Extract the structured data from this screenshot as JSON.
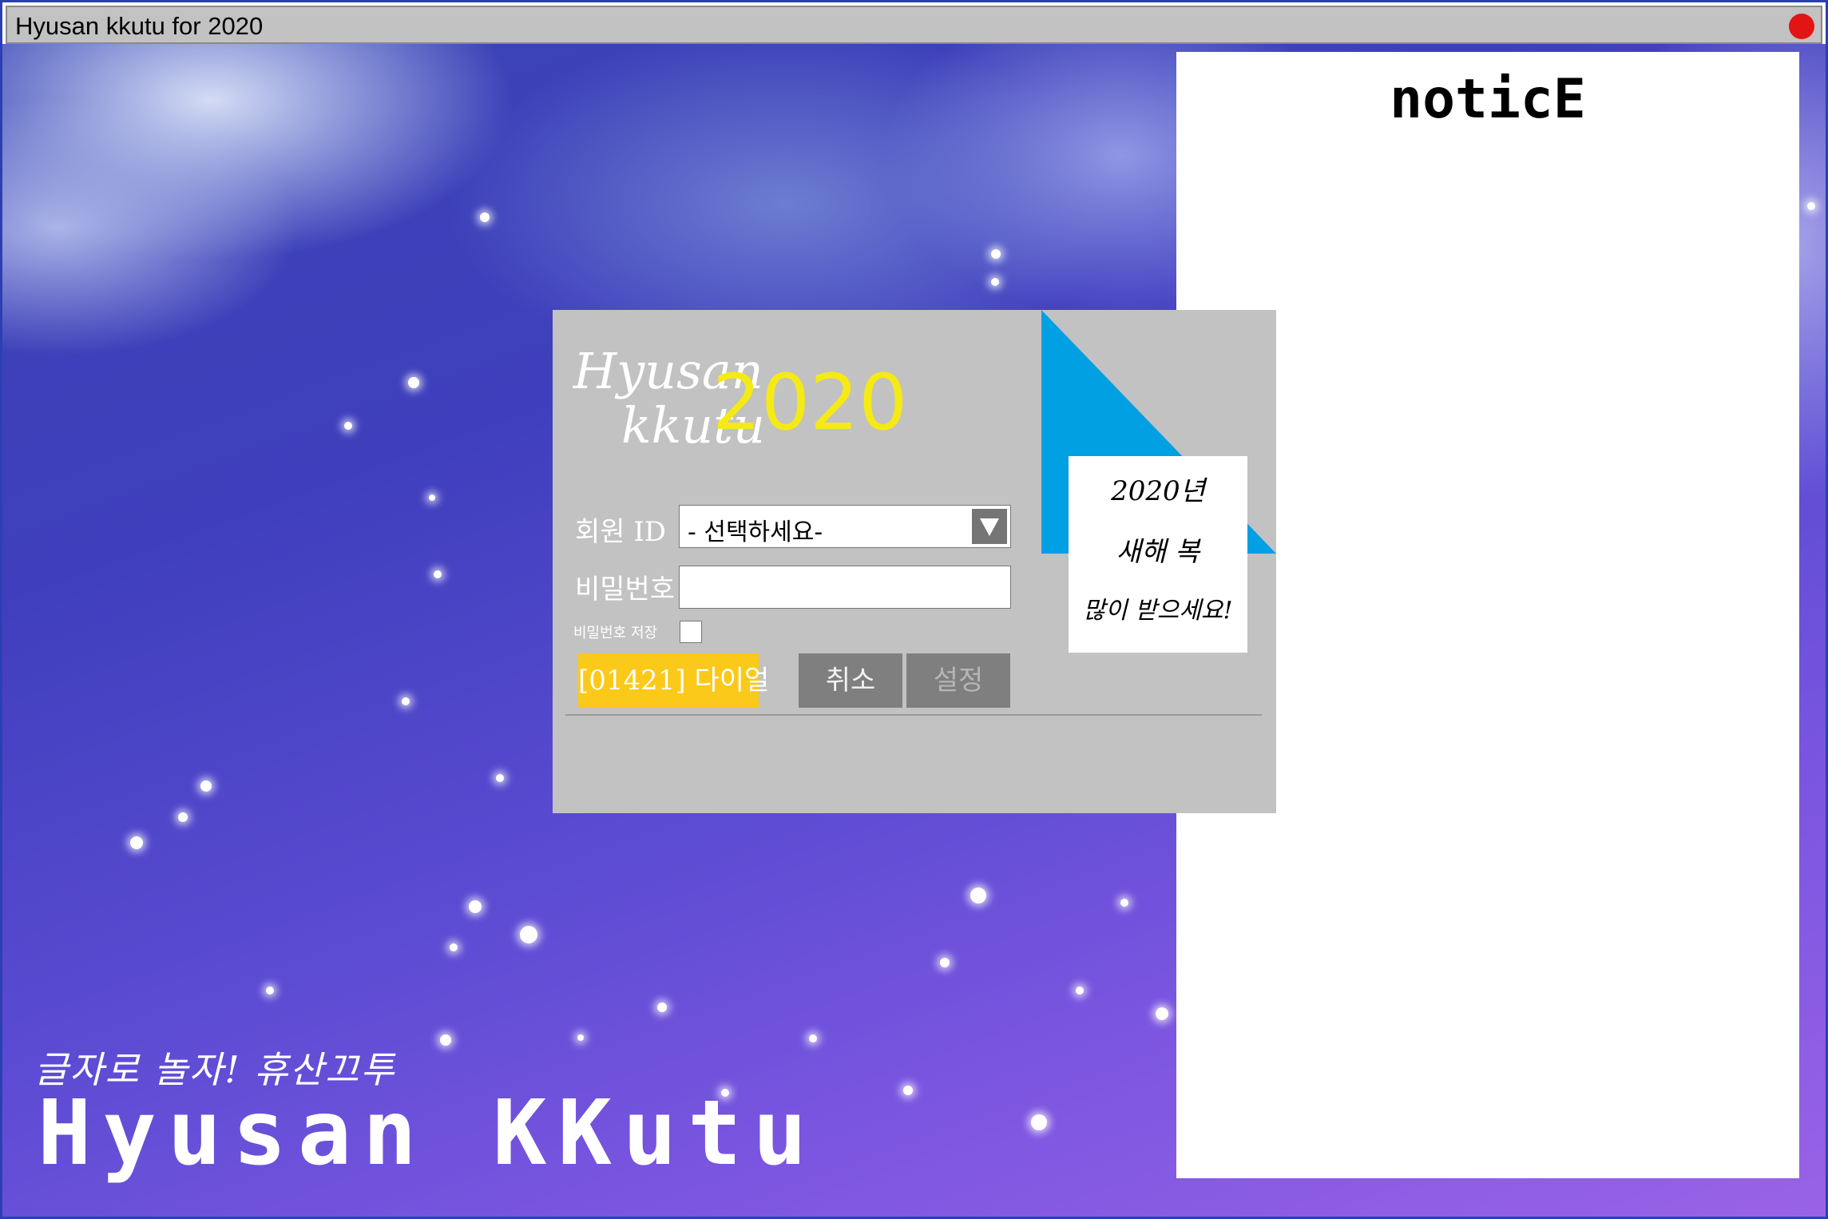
{
  "window": {
    "title": "Hyusan kkutu for 2020",
    "close_color": "#e31414"
  },
  "background": {
    "slogan": "글자로 놀자! 휴산끄투",
    "logo": "Hyusan KKutu"
  },
  "notice": {
    "title": "noticE"
  },
  "login": {
    "logo_line1": "Hyusan",
    "logo_line2": "kkutu",
    "logo_year": "2020",
    "member_id_label": "회원 ID",
    "member_id_selected": "- 선택하세요-",
    "password_label": "비밀번호",
    "password_value": "",
    "save_password_label": "비밀번호 저장",
    "save_password_checked": false,
    "dialer_button": "[01421] 다이얼",
    "cancel_button": "취소",
    "settings_button": "설정",
    "accent_color": "#01a0e2",
    "dialer_color": "#fbc91a"
  },
  "greeting": {
    "line1": "2020년",
    "line2": "새해 복",
    "line3": "많이 받으세요!"
  }
}
